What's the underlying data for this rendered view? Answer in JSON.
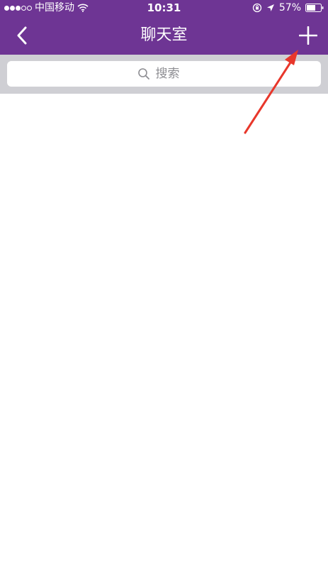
{
  "status_bar": {
    "carrier": "中国移动",
    "time": "10:31",
    "battery": "57%",
    "signal_filled": 3,
    "signal_total": 5
  },
  "nav": {
    "title": "聊天室",
    "back_icon": "chevron-left-icon",
    "add_icon": "plus-icon"
  },
  "search": {
    "placeholder": "搜索",
    "value": ""
  },
  "colors": {
    "header_bg": "#6e3594",
    "search_area_bg": "#cfcfd4",
    "annotation_arrow": "#e8372b"
  }
}
